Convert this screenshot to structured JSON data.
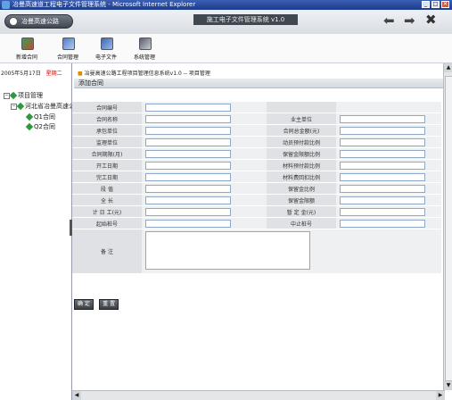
{
  "window": {
    "title": "冶曼高速道工程电子文件管理系统 - Microsoft Internet Explorer",
    "min": "_",
    "max": "□",
    "close": "✕"
  },
  "header": {
    "pill_label": "冶曼高速公路",
    "system_title": "施工电子文件管理系统 v1.0",
    "back": "⬅",
    "forward": "➡",
    "close": "✖"
  },
  "toolbar": {
    "items": [
      {
        "label": "新增合同"
      },
      {
        "label": "合同管理"
      },
      {
        "label": "电子文件"
      },
      {
        "label": "系统管理"
      }
    ]
  },
  "sidebar": {
    "date": "2005年5月17日",
    "logout": "星期二",
    "tree": {
      "root": "项目管理",
      "child": "河北省冶曼高速公路",
      "items": [
        "Q1合同",
        "Q2合同"
      ]
    }
  },
  "content": {
    "breadcrumb": "冶曼高速公路工程项目管理信息系统v1.0 -- 项目管理",
    "section_title": "添加合同",
    "form": {
      "rows": [
        {
          "l1": "合同编号",
          "l2": ""
        },
        {
          "l1": "合同名称",
          "l2": "业主单位"
        },
        {
          "l1": "承包单位",
          "l2": "合同总金额(元)"
        },
        {
          "l1": "监理单位",
          "l2": "动员预付款比例"
        },
        {
          "l1": "合同期限(月)",
          "l2": "保留金限额比例"
        },
        {
          "l1": "开工日期",
          "l2": "材料预付款比例"
        },
        {
          "l1": "完工日期",
          "l2": "材料费回扣比例"
        },
        {
          "l1": "段 值",
          "l2": "保留金比例"
        },
        {
          "l1": "全 长",
          "l2": "保留金限额"
        },
        {
          "l1": "计 日 工(元)",
          "l2": "暂 定 金(元)"
        },
        {
          "l1": "起始桩号",
          "l2": "中止桩号"
        }
      ],
      "notes_label": "备 注"
    },
    "buttons": {
      "save": "确 定",
      "reset": "重 置"
    }
  }
}
